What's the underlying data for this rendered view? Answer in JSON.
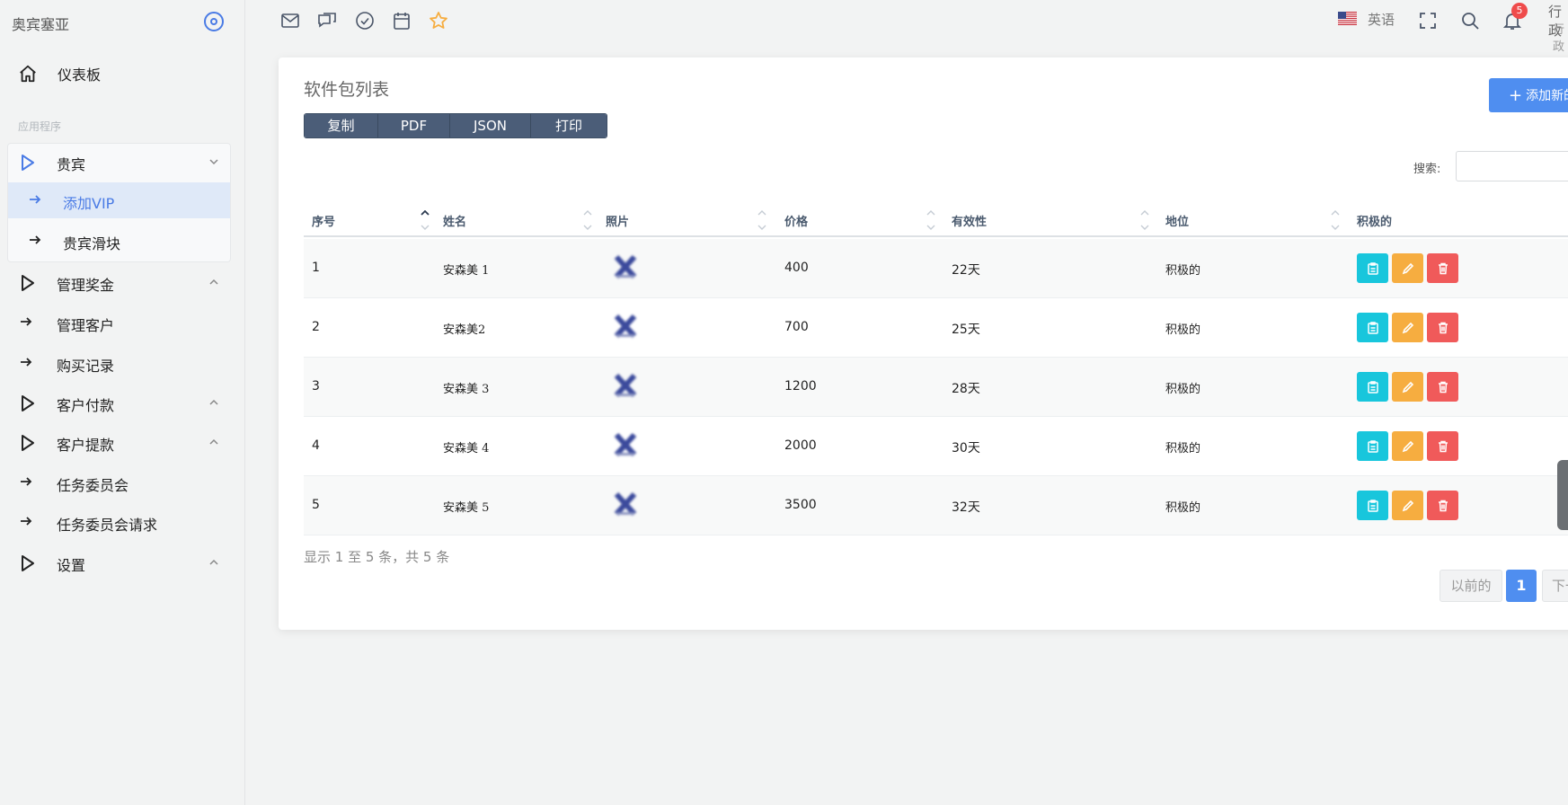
{
  "brand": {
    "name": "奥宾塞亚"
  },
  "sidebar": {
    "dashboard": "仪表板",
    "section_label": "应用程序",
    "items": [
      {
        "label": "贵宾",
        "type": "group",
        "chevron": "down"
      },
      {
        "label": "添加VIP",
        "type": "sub",
        "active": true
      },
      {
        "label": "贵宾滑块",
        "type": "sub"
      },
      {
        "label": "管理奖金",
        "type": "group",
        "chevron": "up"
      },
      {
        "label": "管理客户",
        "type": "link"
      },
      {
        "label": "购买记录",
        "type": "link"
      },
      {
        "label": "客户付款",
        "type": "group",
        "chevron": "up"
      },
      {
        "label": "客户提款",
        "type": "group",
        "chevron": "up"
      },
      {
        "label": "任务委员会",
        "type": "link"
      },
      {
        "label": "任务委员会请求",
        "type": "link"
      },
      {
        "label": "设置",
        "type": "group",
        "chevron": "up"
      }
    ]
  },
  "topbar": {
    "icons": [
      "mail-icon",
      "chat-icon",
      "check-circle-icon",
      "calendar-icon",
      "star-icon"
    ],
    "language": "英语",
    "notifications_count": "5",
    "user_name": "行政",
    "user_role": "行政"
  },
  "card": {
    "title": "软件包列表",
    "add_button": "添加新的",
    "export_buttons": [
      "复制",
      "PDF",
      "JSON",
      "打印"
    ],
    "search_label": "搜索:",
    "search_value": "",
    "columns": [
      "序号",
      "姓名",
      "照片",
      "价格",
      "有效性",
      "地位",
      "积极的"
    ],
    "rows": [
      {
        "id": "1",
        "name": "安森美 1",
        "price": "400",
        "validity": "22天",
        "status": "积极的"
      },
      {
        "id": "2",
        "name": "安森美2",
        "price": "700",
        "validity": "25天",
        "status": "积极的"
      },
      {
        "id": "3",
        "name": "安森美 3",
        "price": "1200",
        "validity": "28天",
        "status": "积极的"
      },
      {
        "id": "4",
        "name": "安森美 4",
        "price": "2000",
        "validity": "30天",
        "status": "积极的"
      },
      {
        "id": "5",
        "name": "安森美 5",
        "price": "3500",
        "validity": "32天",
        "status": "积极的"
      }
    ],
    "info": "显示 1 至 5 条，共 5 条",
    "pagination": {
      "prev": "以前的",
      "current": "1",
      "next": "下一个"
    }
  },
  "colors": {
    "accent": "#4f8ef0",
    "info": "#18c6dc",
    "warning": "#f6ad40",
    "danger": "#f05a5a"
  }
}
